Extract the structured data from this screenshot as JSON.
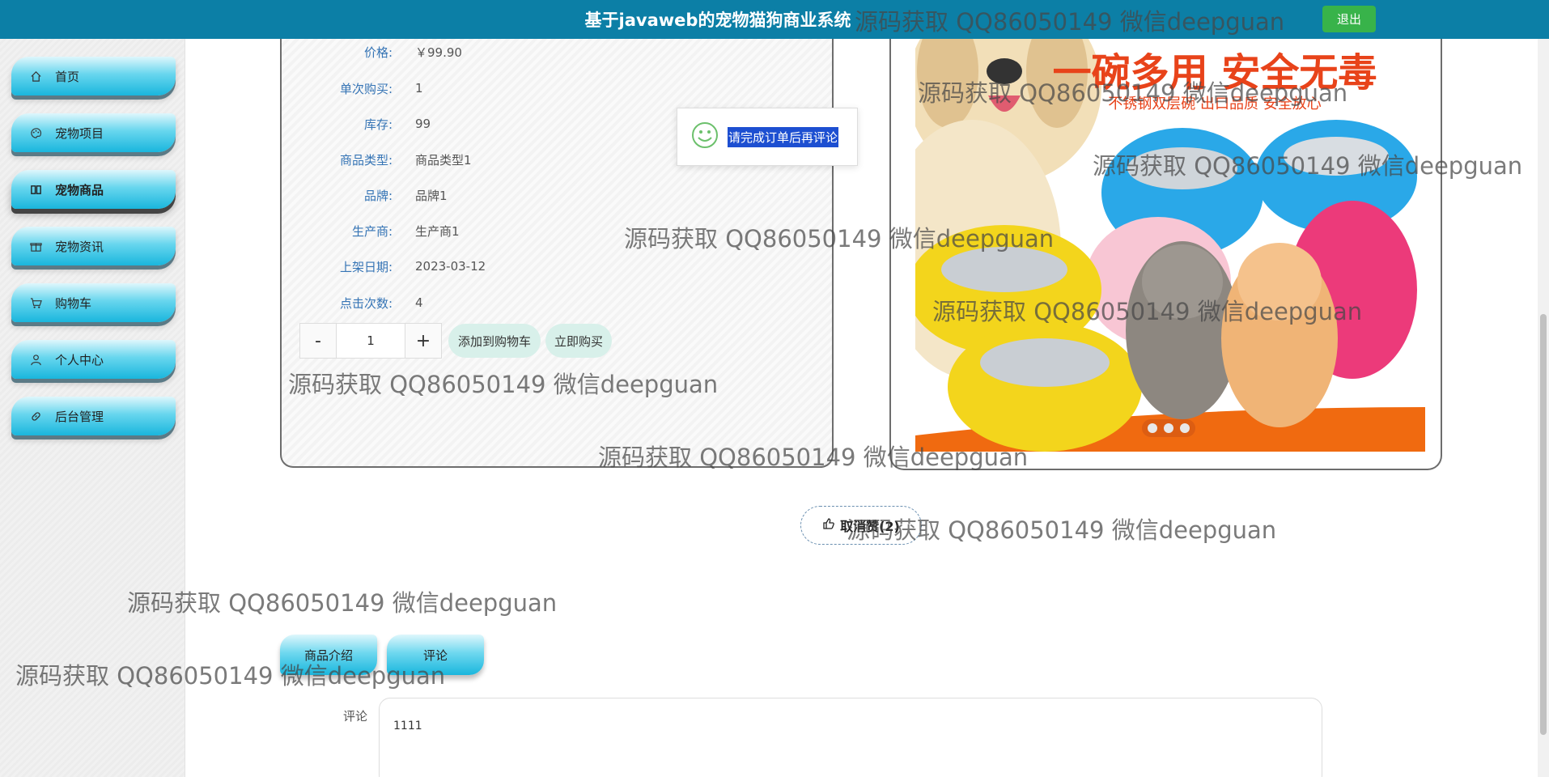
{
  "header": {
    "title": "基于javaweb的宠物猫狗商业系统",
    "logout_label": "退出"
  },
  "sidebar": {
    "items": [
      {
        "label": "首页",
        "icon": "home-icon"
      },
      {
        "label": "宠物项目",
        "icon": "palette-icon"
      },
      {
        "label": "宠物商品",
        "icon": "columns-icon",
        "active": true
      },
      {
        "label": "宠物资讯",
        "icon": "gift-icon"
      },
      {
        "label": "购物车",
        "icon": "cart-icon"
      },
      {
        "label": "个人中心",
        "icon": "user-icon"
      },
      {
        "label": "后台管理",
        "icon": "link-icon"
      }
    ]
  },
  "product": {
    "fields": [
      {
        "label": "价格:",
        "value": "￥99.90"
      },
      {
        "label": "单次购买:",
        "value": "1"
      },
      {
        "label": "库存:",
        "value": "99"
      },
      {
        "label": "商品类型:",
        "value": "商品类型1"
      },
      {
        "label": "品牌:",
        "value": "品牌1"
      },
      {
        "label": "生产商:",
        "value": "生产商1"
      },
      {
        "label": "上架日期:",
        "value": "2023-03-12"
      },
      {
        "label": "点击次数:",
        "value": "4"
      }
    ],
    "quantity": {
      "minus": "-",
      "value": "1",
      "plus": "+"
    },
    "add_to_cart_label": "添加到购物车",
    "buy_now_label": "立即购买"
  },
  "banner": {
    "headline": "一碗多用 安全无毒",
    "subline": "不锈钢双层碗 出口品质 安全放心",
    "carousel_dots": 3,
    "active_dot": 1
  },
  "tooltip": {
    "text": "请完成订单后再评论"
  },
  "like": {
    "label": "取消赞(2)"
  },
  "tabs": [
    {
      "label": "商品介绍"
    },
    {
      "label": "评论"
    }
  ],
  "comment": {
    "label": "评论",
    "value": "1111"
  },
  "watermark": "源码获取 QQ86050149 微信deepguan",
  "colors": {
    "topbar": "#0c7fa6",
    "logout": "#38b34a",
    "nav_gradient_end": "#19b6dd",
    "label_blue": "#3574b5"
  }
}
